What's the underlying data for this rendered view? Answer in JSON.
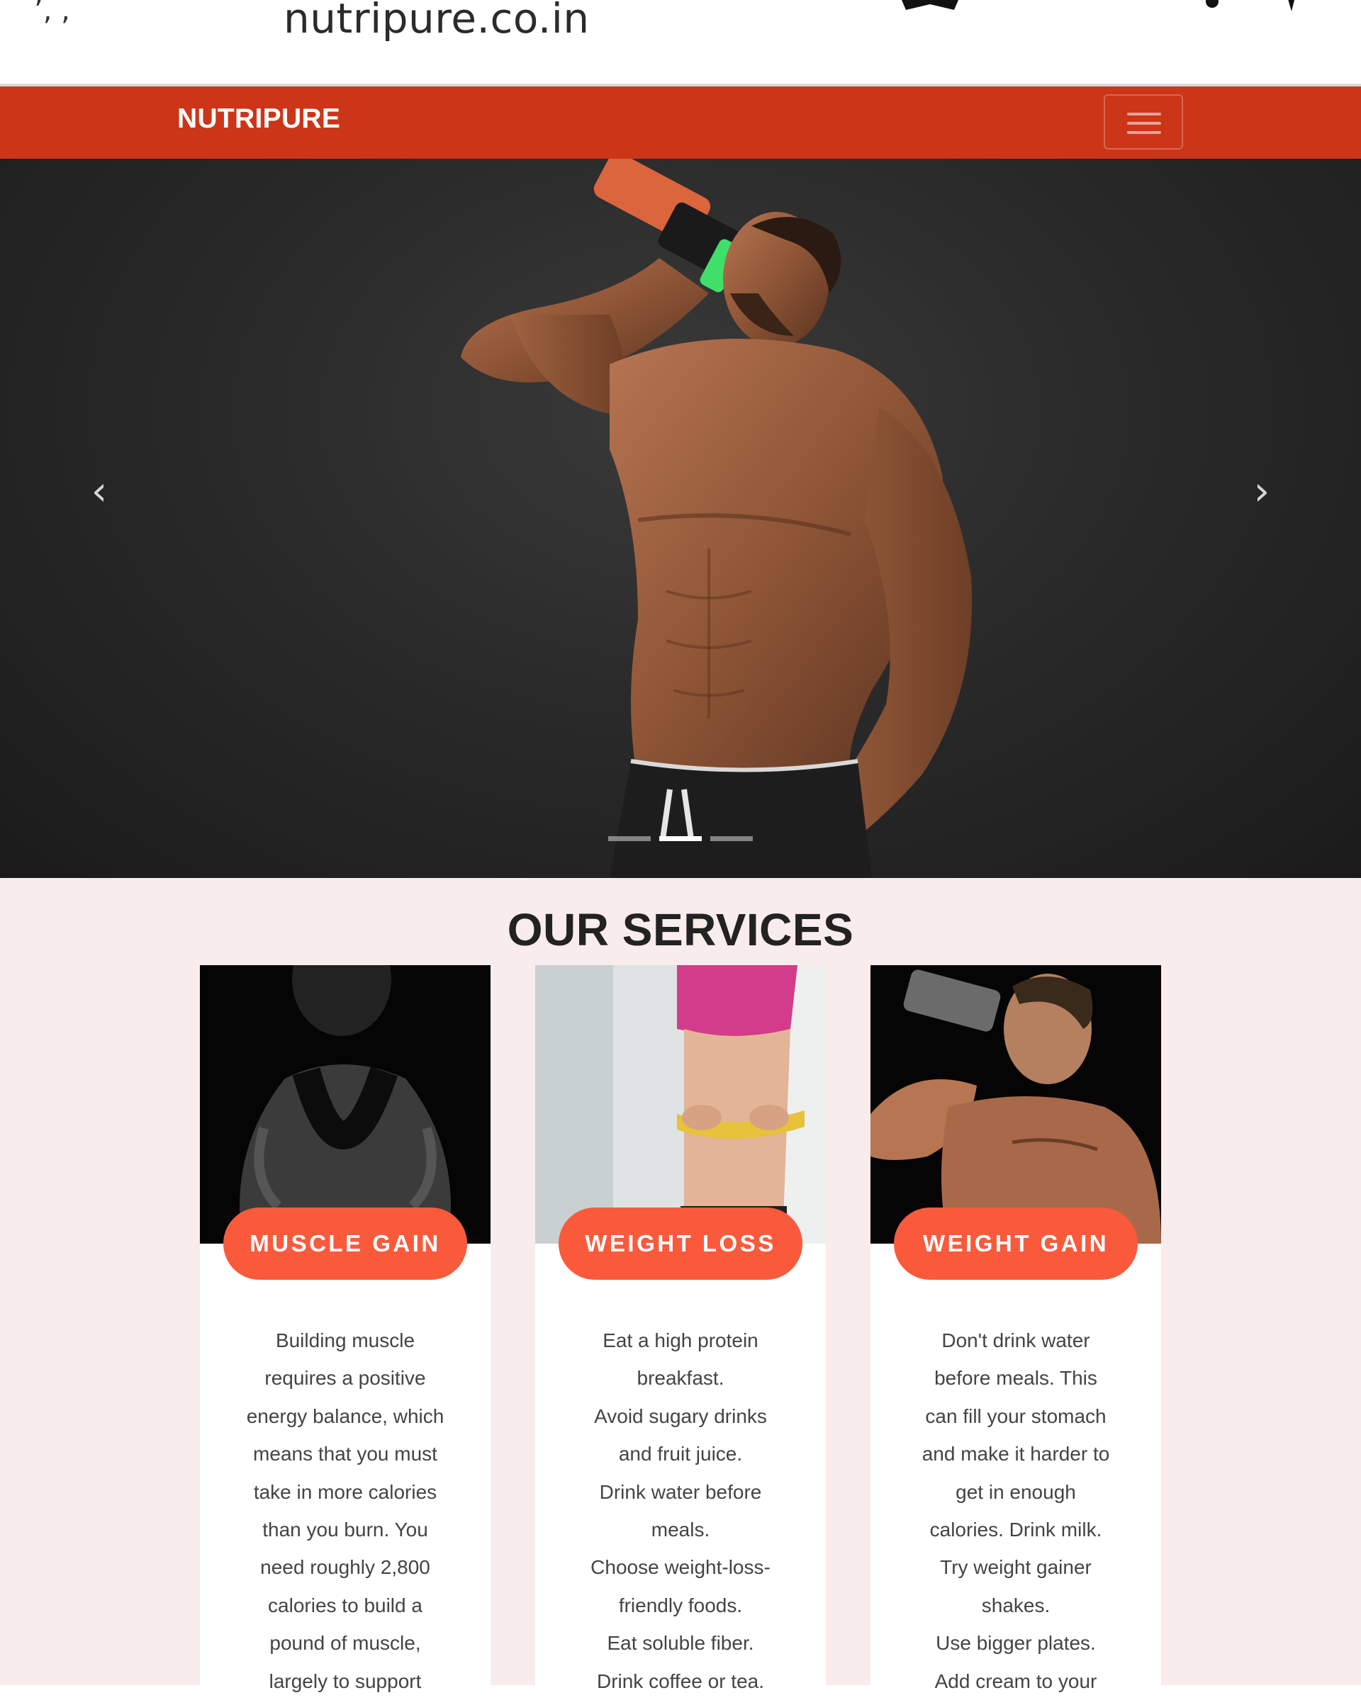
{
  "browser": {
    "url": "nutripure.co.in",
    "corner_text": "’, ,"
  },
  "navbar": {
    "brand": "NUTRIPURE"
  },
  "carousel": {
    "prev_glyph": "‹",
    "next_glyph": "›",
    "indicator_count": 3,
    "active_index": 1
  },
  "services": {
    "title": "OUR SERVICES",
    "cards": [
      {
        "label": "MUSCLE GAIN",
        "lines": [
          "Building muscle",
          "requires a positive",
          "energy balance, which",
          "means that you must",
          "take in more calories",
          "than you burn. You",
          "need roughly 2,800",
          "calories to build a",
          "pound of muscle,",
          "largely to support"
        ]
      },
      {
        "label": "WEIGHT LOSS",
        "lines": [
          "Eat a high protein",
          "breakfast.",
          "Avoid sugary drinks",
          "and fruit juice.",
          "Drink water before",
          "meals.",
          "Choose weight-loss-",
          "friendly foods.",
          "Eat soluble fiber.",
          "Drink coffee or tea."
        ]
      },
      {
        "label": "WEIGHT GAIN",
        "lines": [
          "Don't drink water",
          "before meals. This",
          "can fill your stomach",
          "and make it harder to",
          "get in enough",
          "calories. Drink milk.",
          "Try weight gainer",
          "shakes.",
          "Use bigger plates.",
          "Add cream to your"
        ]
      }
    ]
  },
  "colors": {
    "navbar": "#cc3518",
    "pill": "#fa5a3c",
    "services_bg": "#f8ecec",
    "hero_bg": "#2a2a2a"
  }
}
